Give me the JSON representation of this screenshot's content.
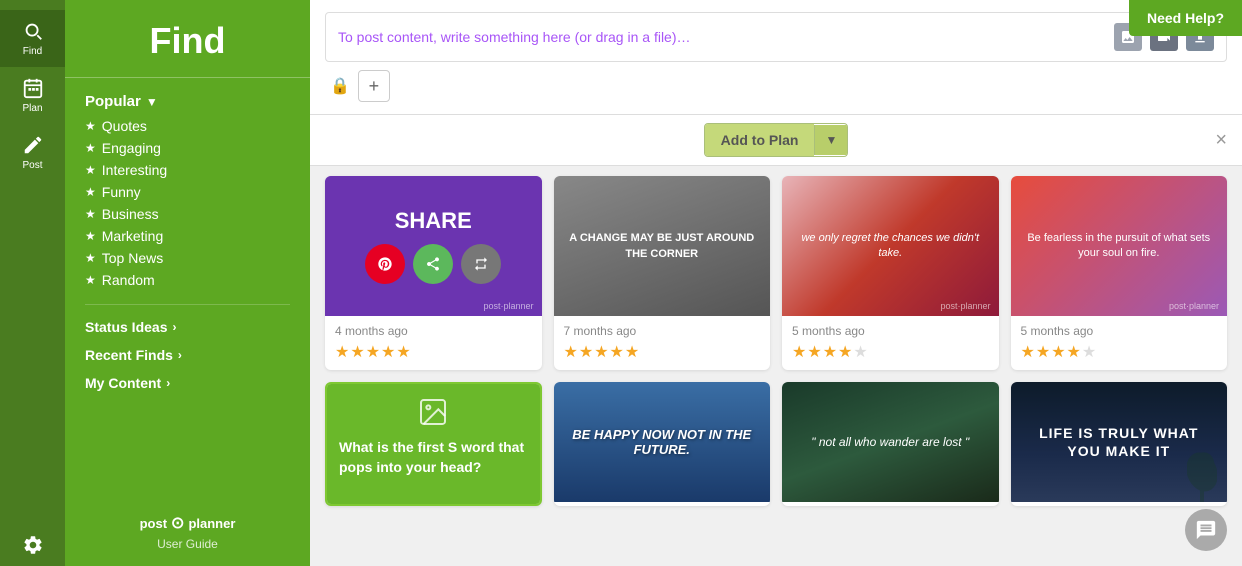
{
  "app": {
    "title": "Find",
    "need_help": "Need Help?",
    "logo_text": "post planner",
    "user_guide": "User Guide"
  },
  "left_nav": {
    "items": [
      {
        "id": "find",
        "label": "Find",
        "icon": "search",
        "active": true
      },
      {
        "id": "plan",
        "label": "Plan",
        "icon": "calendar",
        "active": false
      },
      {
        "id": "post",
        "label": "Post",
        "icon": "pencil",
        "active": false
      },
      {
        "id": "settings",
        "label": "",
        "icon": "gear",
        "active": false
      }
    ]
  },
  "sidebar": {
    "title": "Find",
    "popular_label": "Popular",
    "items": [
      {
        "id": "quotes",
        "label": "Quotes"
      },
      {
        "id": "engaging",
        "label": "Engaging"
      },
      {
        "id": "interesting",
        "label": "Interesting"
      },
      {
        "id": "funny",
        "label": "Funny"
      },
      {
        "id": "business",
        "label": "Business"
      },
      {
        "id": "marketing",
        "label": "Marketing"
      },
      {
        "id": "top-news",
        "label": "Top News"
      },
      {
        "id": "random",
        "label": "Random"
      }
    ],
    "status_ideas_label": "Status Ideas",
    "recent_finds_label": "Recent Finds",
    "my_content_label": "My Content"
  },
  "toolbar": {
    "placeholder": "To post content, write something here (or drag in a file)…",
    "add_to_plan_label": "Add to Plan",
    "close_label": "×"
  },
  "cards_row1": [
    {
      "id": "card1",
      "type": "share-overlay",
      "bg": "purple",
      "date": "4 months ago",
      "stars": 5,
      "overlay_text": "SHARE",
      "branding": "post·planner"
    },
    {
      "id": "card2",
      "type": "image-text",
      "bg": "gray",
      "date": "7 months ago",
      "stars": 5,
      "quote": "A CHANGE MAY BE JUST AROUND THE CORNER",
      "branding": ""
    },
    {
      "id": "card3",
      "type": "image-text",
      "bg": "cherry-blossom",
      "date": "5 months ago",
      "stars": 4,
      "quote": "we only regret the chances we didn't take.",
      "branding": "post·planner"
    },
    {
      "id": "card4",
      "type": "image-text",
      "bg": "sunset",
      "date": "5 months ago",
      "stars": 4,
      "quote": "Be fearless in the pursuit of what sets your soul on fire.",
      "branding": "post·planner"
    }
  ],
  "cards_row2": [
    {
      "id": "card5",
      "type": "featured-text",
      "bg": "green",
      "text": "What is the first S word that pops into your head?",
      "icon": "picture"
    },
    {
      "id": "card6",
      "type": "image-text",
      "bg": "blue-sneaker",
      "text": "BE HAPPY NOW NOT IN THE FUTURE."
    },
    {
      "id": "card7",
      "type": "image-text",
      "bg": "dark-forest",
      "text": "\" not all who wander are lost \""
    },
    {
      "id": "card8",
      "type": "image-text",
      "bg": "night-city",
      "text": "LIFE IS TRULY WHAT YOU MAKE IT"
    }
  ],
  "colors": {
    "primary_green": "#5da822",
    "dark_green": "#4a7c20",
    "accent_yellow": "#c5d97a",
    "purple": "#7c3aed",
    "star_gold": "#f5a623"
  }
}
